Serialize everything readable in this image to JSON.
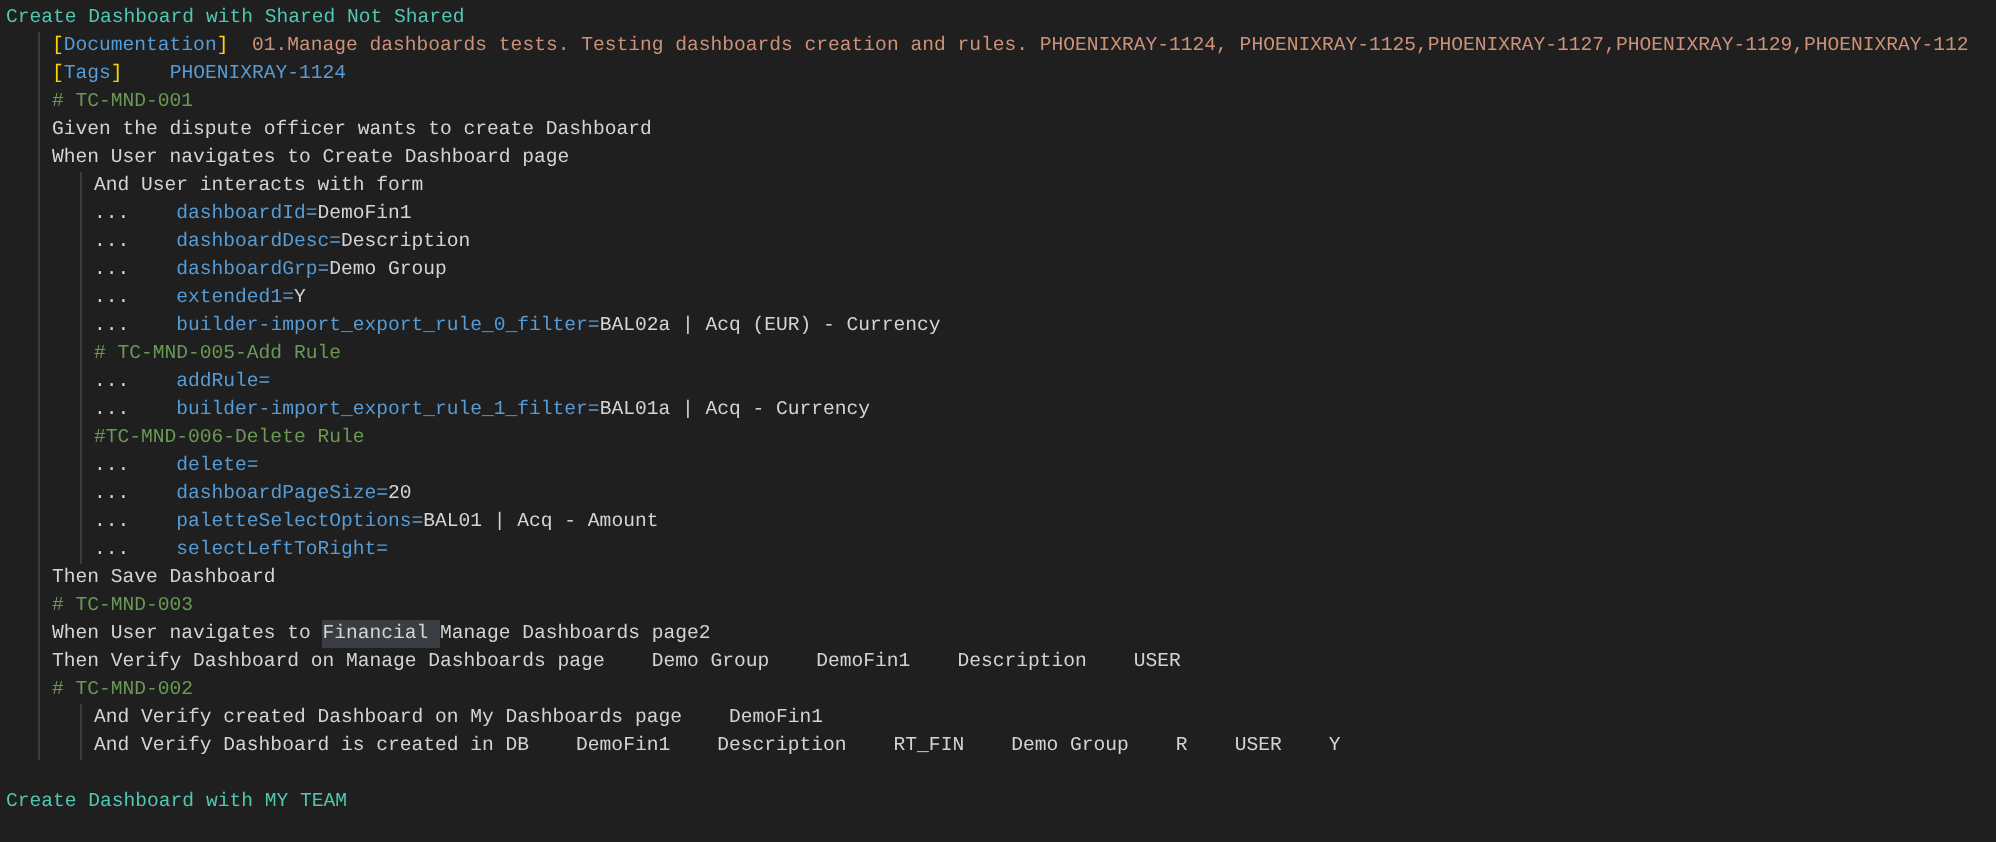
{
  "editor": {
    "lines": [
      {
        "tokens": [
          {
            "kind": "heading",
            "text": "Create Dashboard with Shared Not Shared"
          }
        ],
        "children": [
          {
            "tokens": [
              {
                "kind": "setting",
                "text": "[Documentation]"
              },
              {
                "kind": "doc",
                "text": "01.Manage dashboards tests. Testing dashboards creation and rules. PHOENIXRAY-1124, PHOENIXRAY-1125,PHOENIXRAY-1127,PHOENIXRAY-1129,PHOENIXRAY-112"
              }
            ]
          },
          {
            "tokens": [
              {
                "kind": "setting",
                "text": "[Tags]"
              },
              {
                "kind": "tag",
                "text": "PHOENIXRAY-1124"
              }
            ]
          },
          {
            "tokens": [
              {
                "kind": "comment",
                "text": "# TC-MND-001"
              }
            ]
          },
          {
            "tokens": [
              {
                "kind": "step",
                "text": "Given the dispute officer wants to create Dashboard"
              }
            ]
          },
          {
            "tokens": [
              {
                "kind": "step",
                "text": "When User navigates to Create Dashboard page"
              }
            ],
            "children": [
              {
                "tokens": [
                  {
                    "kind": "step",
                    "text": "And User interacts with form"
                  }
                ]
              },
              {
                "tokens": [
                  {
                    "kind": "cont",
                    "text": "..."
                  },
                  {
                    "kind": "arg",
                    "name": "dashboardId=",
                    "value": "DemoFin1"
                  }
                ]
              },
              {
                "tokens": [
                  {
                    "kind": "cont",
                    "text": "..."
                  },
                  {
                    "kind": "arg",
                    "name": "dashboardDesc=",
                    "value": "Description"
                  }
                ]
              },
              {
                "tokens": [
                  {
                    "kind": "cont",
                    "text": "..."
                  },
                  {
                    "kind": "arg",
                    "name": "dashboardGrp=",
                    "value": "Demo Group"
                  }
                ]
              },
              {
                "tokens": [
                  {
                    "kind": "cont",
                    "text": "..."
                  },
                  {
                    "kind": "arg",
                    "name": "extended1=",
                    "value": "Y"
                  }
                ]
              },
              {
                "tokens": [
                  {
                    "kind": "cont",
                    "text": "..."
                  },
                  {
                    "kind": "arg",
                    "name": "builder-import_export_rule_0_filter=",
                    "value": "BAL02a | Acq (EUR) - Currency"
                  }
                ]
              },
              {
                "tokens": [
                  {
                    "kind": "comment",
                    "text": "# TC-MND-005-Add Rule"
                  }
                ]
              },
              {
                "tokens": [
                  {
                    "kind": "cont",
                    "text": "..."
                  },
                  {
                    "kind": "arg",
                    "name": "addRule="
                  }
                ]
              },
              {
                "tokens": [
                  {
                    "kind": "cont",
                    "text": "..."
                  },
                  {
                    "kind": "arg",
                    "name": "builder-import_export_rule_1_filter=",
                    "value": "BAL01a | Acq - Currency"
                  }
                ]
              },
              {
                "tokens": [
                  {
                    "kind": "comment",
                    "text": "#TC-MND-006-Delete Rule"
                  }
                ]
              },
              {
                "tokens": [
                  {
                    "kind": "cont",
                    "text": "..."
                  },
                  {
                    "kind": "arg",
                    "name": "delete="
                  }
                ]
              },
              {
                "tokens": [
                  {
                    "kind": "cont",
                    "text": "..."
                  },
                  {
                    "kind": "arg",
                    "name": "dashboardPageSize=",
                    "value": "20"
                  }
                ]
              },
              {
                "tokens": [
                  {
                    "kind": "cont",
                    "text": "..."
                  },
                  {
                    "kind": "arg",
                    "name": "paletteSelectOptions=",
                    "value": "BAL01 | Acq - Amount"
                  }
                ]
              },
              {
                "tokens": [
                  {
                    "kind": "cont",
                    "text": "..."
                  },
                  {
                    "kind": "arg",
                    "name": "selectLeftToRight="
                  }
                ]
              }
            ]
          },
          {
            "tokens": [
              {
                "kind": "step",
                "text": "Then Save Dashboard"
              }
            ]
          },
          {
            "tokens": [
              {
                "kind": "comment",
                "text": "# TC-MND-003"
              }
            ]
          },
          {
            "tokens": [
              {
                "kind": "step",
                "text": "When User navigates to"
              },
              {
                "kind": "highlight",
                "text": "Financial"
              },
              {
                "kind": "step",
                "text": "Manage Dashboards page2"
              }
            ]
          },
          {
            "tokens": [
              {
                "kind": "step",
                "text": "Then Verify Dashboard on Manage Dashboards page"
              },
              {
                "kind": "cell",
                "text": "Demo Group"
              },
              {
                "kind": "cell",
                "text": "DemoFin1"
              },
              {
                "kind": "cell",
                "text": "Description"
              },
              {
                "kind": "cell",
                "text": "USER"
              }
            ]
          },
          {
            "tokens": [
              {
                "kind": "comment",
                "text": "# TC-MND-002"
              }
            ],
            "children": [
              {
                "tokens": [
                  {
                    "kind": "step",
                    "text": "And Verify created Dashboard on My Dashboards page"
                  },
                  {
                    "kind": "cell",
                    "text": "DemoFin1"
                  }
                ]
              },
              {
                "tokens": [
                  {
                    "kind": "step",
                    "text": "And Verify Dashboard is created in DB"
                  },
                  {
                    "kind": "cell",
                    "text": "DemoFin1"
                  },
                  {
                    "kind": "cell",
                    "text": "Description"
                  },
                  {
                    "kind": "cell",
                    "text": "RT_FIN"
                  },
                  {
                    "kind": "cell",
                    "text": "Demo Group"
                  },
                  {
                    "kind": "cell",
                    "text": "R"
                  },
                  {
                    "kind": "cell",
                    "text": "USER"
                  },
                  {
                    "kind": "cell",
                    "text": "Y"
                  }
                ]
              }
            ]
          }
        ]
      },
      {
        "tokens": [
          {
            "kind": "heading",
            "text": "Create Dashboard with MY TEAM"
          }
        ]
      }
    ]
  }
}
